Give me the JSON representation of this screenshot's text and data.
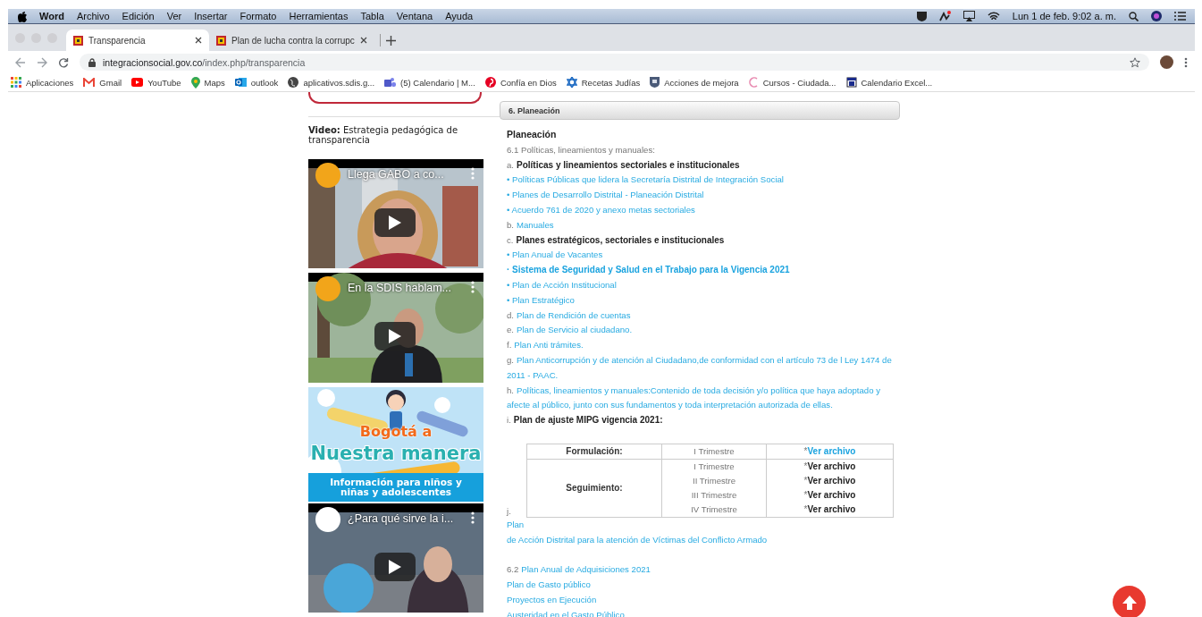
{
  "menu_bar": {
    "app": "Word",
    "items": [
      "Archivo",
      "Edición",
      "Ver",
      "Insertar",
      "Formato",
      "Herramientas",
      "Tabla",
      "Ventana",
      "Ayuda"
    ],
    "clock": "Lun 1 de feb.  9:02 a. m."
  },
  "tabs": [
    {
      "title": "Transparencia",
      "selected": true
    },
    {
      "title": "Plan de lucha contra la corrupc",
      "selected": false
    }
  ],
  "address_bar": {
    "domain": "integracionsocial.gov.co",
    "path": "/index.php/transparencia"
  },
  "bookmarks": [
    "Aplicaciones",
    "Gmail",
    "YouTube",
    "Maps",
    "outlook",
    "aplicativos.sdis.g...",
    "(5) Calendario | M...",
    "Confía en Dios",
    "Recetas Judías",
    "Acciones de mejora",
    "Cursos - Ciudada...",
    "Calendario Excel..."
  ],
  "sidebar": {
    "video_heading": {
      "label": "Video:",
      "text": "Estrategia pedagógica de transparencia"
    },
    "items": [
      {
        "kind": "video",
        "title": "Llega GABO a co..."
      },
      {
        "kind": "video",
        "title": "En la SDIS hablam..."
      },
      {
        "kind": "banner",
        "title": "Bogotá a",
        "subtitle": "Nuestra manera",
        "caption": "Información para niños y niñas y adolescentes"
      },
      {
        "kind": "video",
        "title": "¿Para qué sirve la i..."
      }
    ]
  },
  "panel": {
    "header": "6. Planeación",
    "lines": [
      {
        "kind": "heading",
        "text": "Planeación"
      },
      {
        "kind": "plain",
        "text": "6.1 Políticas, lineamientos y manuales:"
      },
      {
        "kind": "bold",
        "prefix": "a.",
        "text": "Políticas y lineamientos sectoriales e institucionales"
      },
      {
        "kind": "link",
        "text": "• Políticas Públicas que lidera la Secretaría Distrital de Integración Social"
      },
      {
        "kind": "link",
        "text": "• Planes de Desarrollo Distrital - Planeación Distrital"
      },
      {
        "kind": "link",
        "text": "• Acuerdo 761 de 2020 y anexo metas sectoriales"
      },
      {
        "kind": "link",
        "prefix": "b.",
        "text": "Manuales"
      },
      {
        "kind": "bold",
        "prefix": "c.",
        "text": "Planes estratégicos, sectoriales e institucionales"
      },
      {
        "kind": "link",
        "text": "• Plan Anual de Vacantes"
      },
      {
        "kind": "strong_link",
        "text": "· Sistema de Seguridad y Salud en el Trabajo para la Vigencia 2021"
      },
      {
        "kind": "link",
        "text": "• Plan de Acción Institucional"
      },
      {
        "kind": "link",
        "text": "• Plan Estratégico"
      },
      {
        "kind": "link",
        "prefix": "d.",
        "text": "Plan de Rendición de cuentas"
      },
      {
        "kind": "link",
        "prefix": "e.",
        "text": "Plan de Servicio al ciudadano."
      },
      {
        "kind": "link",
        "prefix": "f.",
        "text": "Plan Anti trámites."
      },
      {
        "kind": "link",
        "prefix": "g.",
        "text": "Plan Anticorrupción y de atención al Ciudadano,de conformidad con el artículo 73 de l Ley 1474 de 2011 - PAAC."
      },
      {
        "kind": "link",
        "prefix": "h.",
        "text": "Políticas, lineamientos y manuales:Contenido de toda decisión y/o política que haya adoptado y afecte al público, junto con sus fundamentos y toda interpretación autorizada de ellas."
      },
      {
        "kind": "bold",
        "prefix": "i.",
        "text": "Plan de ajuste MIPG vigencia 2021:"
      },
      {
        "kind": "blank"
      },
      {
        "kind": "table",
        "side_label": "j.",
        "groups": [
          {
            "phase": "Formulación:",
            "periods": [
              {
                "period": "I Trimestre",
                "marker": "*",
                "file": "Ver archivo",
                "linked": true
              }
            ]
          },
          {
            "phase": "Seguimiento:",
            "periods": [
              {
                "period": "I Trimestre",
                "marker": "*",
                "file": "Ver archivo",
                "linked": false
              },
              {
                "period": "II Trimestre",
                "marker": "*",
                "file": "Ver archivo",
                "linked": false
              },
              {
                "period": "III Trimestre",
                "marker": "*",
                "file": "Ver archivo",
                "linked": false
              },
              {
                "period": "IV Trimestre",
                "marker": "*",
                "file": "Ver archivo",
                "linked": false
              }
            ]
          }
        ]
      },
      {
        "kind": "link",
        "text": "Plan"
      },
      {
        "kind": "link",
        "text": "de Acción Distrital para la atención de Víctimas del Conflicto Armado"
      },
      {
        "kind": "blank"
      },
      {
        "kind": "link",
        "prefix": "6.2",
        "text": "Plan Anual de Adquisiciones 2021"
      },
      {
        "kind": "link",
        "text": "Plan de Gasto público"
      },
      {
        "kind": "link",
        "text": "Proyectos en Ejecución"
      },
      {
        "kind": "link",
        "text": "Austeridad en el Gasto Público"
      }
    ]
  }
}
